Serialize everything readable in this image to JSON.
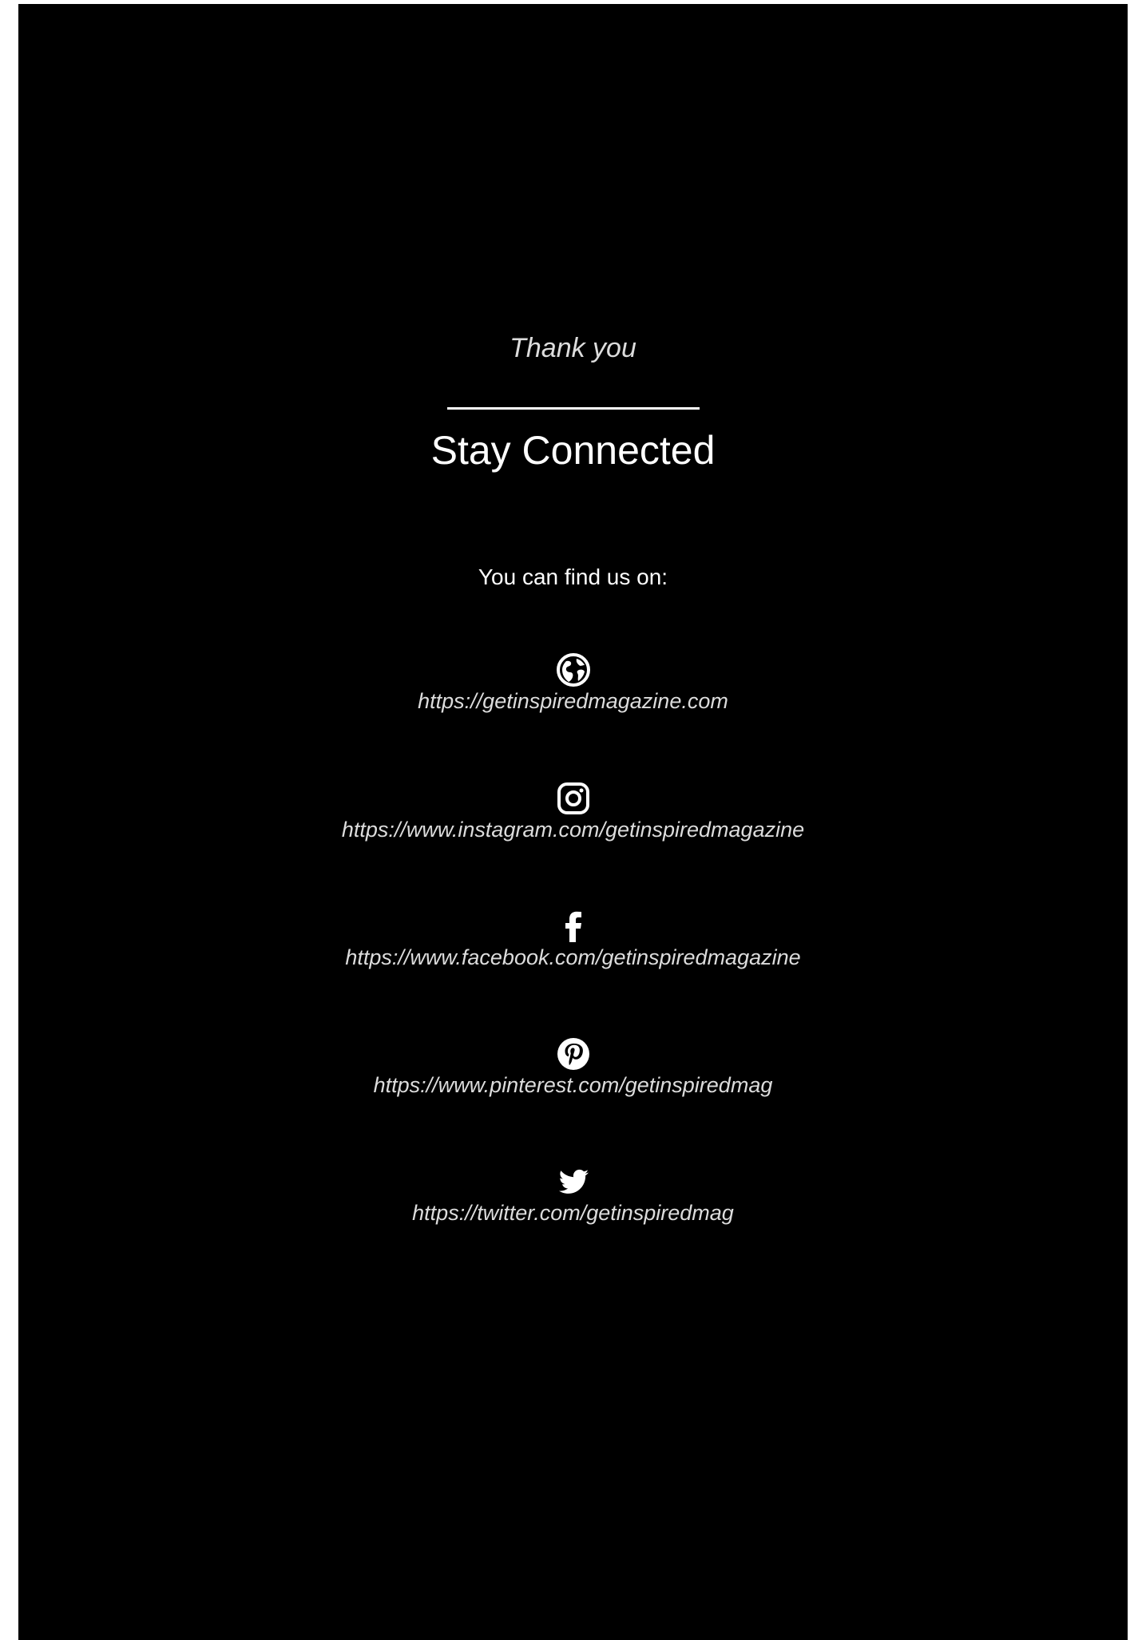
{
  "header": {
    "thank_you": "Thank you",
    "title": "Stay Connected",
    "subtitle": "You can find us on:"
  },
  "social": [
    {
      "name": "Website",
      "icon": "globe-icon",
      "url": "https://getinspiredmagazine.com"
    },
    {
      "name": "Instagram",
      "icon": "instagram-icon",
      "url": "https://www.instagram.com/getinspiredmagazine"
    },
    {
      "name": "Facebook",
      "icon": "facebook-icon",
      "url": "https://www.facebook.com/getinspiredmagazine"
    },
    {
      "name": "Pinterest",
      "icon": "pinterest-icon",
      "url": "https://www.pinterest.com/getinspiredmag"
    },
    {
      "name": "Twitter",
      "icon": "twitter-icon",
      "url": "https://twitter.com/getinspiredmag"
    }
  ],
  "colors": {
    "background": "#000000",
    "text": "#ffffff",
    "link": "#dcdcdc"
  }
}
